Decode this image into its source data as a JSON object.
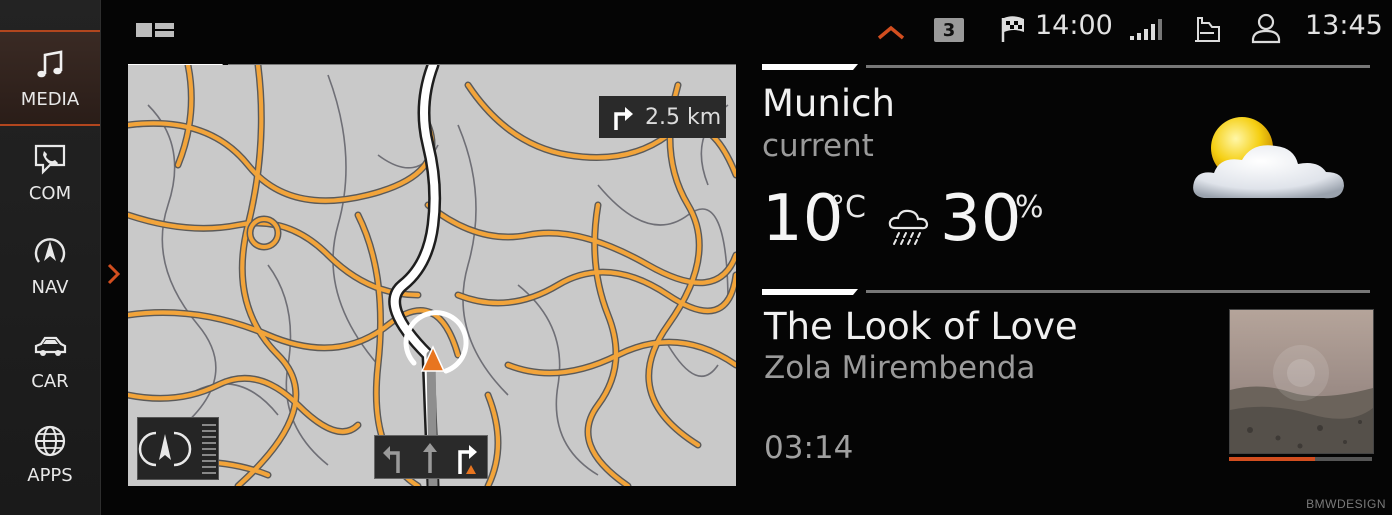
{
  "status_bar": {
    "notification_count": "3",
    "arrival_time": "14:00",
    "clock": "13:45"
  },
  "sidebar": {
    "items": [
      {
        "label": "MEDIA",
        "icon": "music-note-icon",
        "active": true
      },
      {
        "label": "COM",
        "icon": "phone-chat-icon",
        "active": false
      },
      {
        "label": "NAV",
        "icon": "navigation-icon",
        "active": false
      },
      {
        "label": "CAR",
        "icon": "car-icon",
        "active": false
      },
      {
        "label": "APPS",
        "icon": "globe-icon",
        "active": false
      }
    ]
  },
  "map": {
    "next_turn_distance": "2.5 km",
    "next_turn_icon": "turn-right-icon"
  },
  "weather": {
    "city": "Munich",
    "subtitle": "current",
    "temperature": "10",
    "temperature_unit": "°C",
    "precipitation": "30",
    "precipitation_unit": "%",
    "condition_icon": "partly-cloudy-icon"
  },
  "media": {
    "title": "The Look of Love",
    "artist": "Zola Mirembenda",
    "elapsed": "03:14",
    "progress": 0.6
  },
  "colors": {
    "accent": "#d24e1f",
    "road": "#f2a43a",
    "map_bg": "#c9c9c9"
  },
  "watermark": "BMWDESIGN"
}
